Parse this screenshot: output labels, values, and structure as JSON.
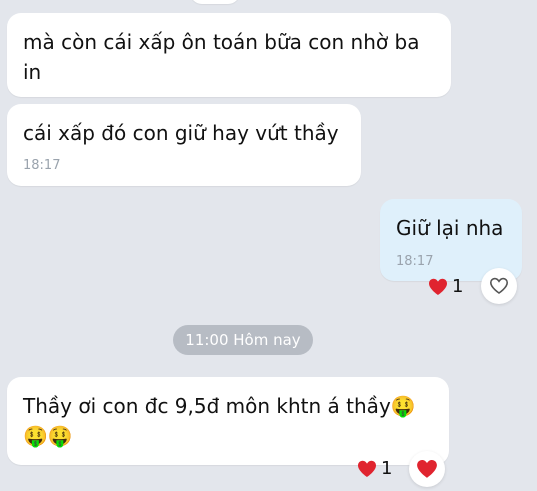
{
  "messages": [
    {
      "text": "mà còn cái xấp ôn toán bữa con nhờ ba\nin",
      "time": ""
    },
    {
      "text": "cái xấp đó con giữ hay vứt thầy",
      "time": "18:17"
    },
    {
      "text": "Giữ lại nha",
      "time": "18:17",
      "reaction_count": "1",
      "reaction_icon": "heart-icon"
    },
    {
      "text": "Thầy ơi con đc 9,5đ môn khtn á thầy🤑\n🤑🤑",
      "reaction_count": "1",
      "reaction_icon": "heart-icon"
    }
  ],
  "divider": {
    "label": "11:00 Hôm nay"
  },
  "colors": {
    "background": "#e3e6ec",
    "incoming_bubble": "#ffffff",
    "outgoing_bubble": "#dff0fb",
    "heart": "#e0242f",
    "divider_pill": "#b7bcc4"
  }
}
